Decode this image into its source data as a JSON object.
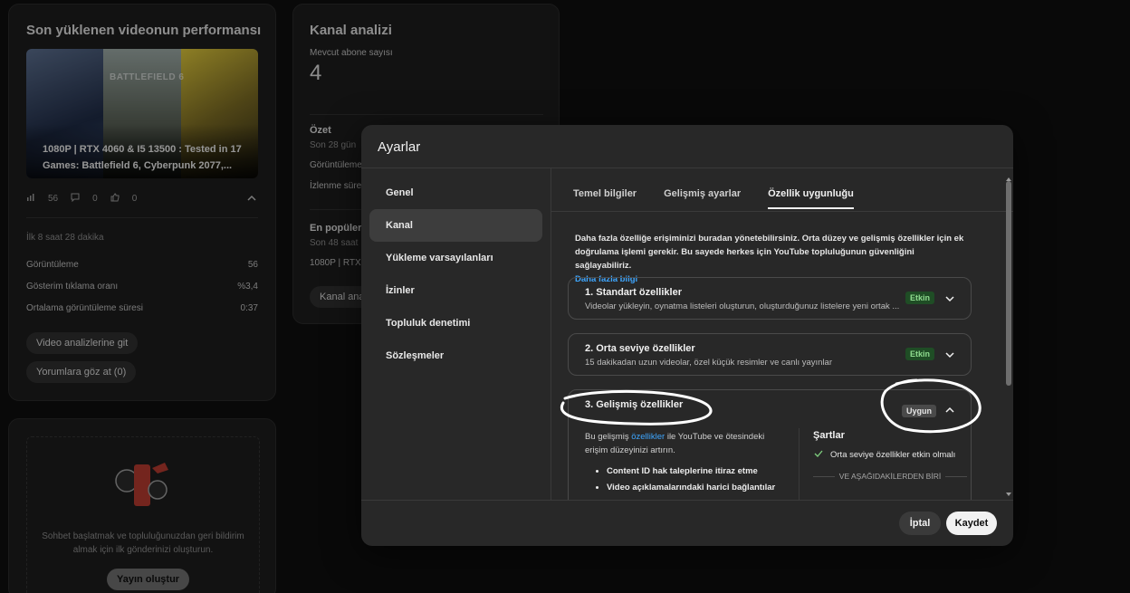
{
  "background": {
    "latest_video_card": {
      "title": "Son yüklenen videonun performansı",
      "thumb_labels": [
        "BATTLEFIELD 6"
      ],
      "video_title": "1080P | RTX 4060 & I5 13500 : Tested in 17 Games: Battlefield 6, Cyberpunk 2077,...",
      "views_count": "56",
      "comments_count": "0",
      "likes_count": "0",
      "period": "İlk 8 saat 28 dakika",
      "stats": [
        {
          "label": "Görüntüleme",
          "value": "56"
        },
        {
          "label": "Gösterim tıklama oranı",
          "value": "%3,4"
        },
        {
          "label": "Ortalama görüntüleme süresi",
          "value": "0:37"
        }
      ],
      "btn_analytics": "Video analizlerine git",
      "btn_comments": "Yorumlara göz at (0)"
    },
    "channel_card": {
      "title": "Kanal analizi",
      "subs_label": "Mevcut abone sayısı",
      "subs_value": "4",
      "summary_title": "Özet",
      "summary_period": "Son 28 gün",
      "summary_row1": "Görüntüleme",
      "summary_row2": "İzlenme süresi",
      "popular_title": "En popüler",
      "popular_period": "Son 48 saat",
      "popular_item": "1080P | RTX 4",
      "btn_channel": "Kanal ana"
    },
    "community_card": {
      "text": "Sohbet başlatmak ve topluluğunuzdan geri bildirim almak için ilk gönderinizi oluşturun.",
      "btn_create": "Yayın oluştur"
    }
  },
  "modal": {
    "title": "Ayarlar",
    "nav": [
      {
        "label": "Genel"
      },
      {
        "label": "Kanal"
      },
      {
        "label": "Yükleme varsayılanları"
      },
      {
        "label": "İzinler"
      },
      {
        "label": "Topluluk denetimi"
      },
      {
        "label": "Sözleşmeler"
      }
    ],
    "tabs": [
      {
        "label": "Temel bilgiler"
      },
      {
        "label": "Gelişmiş ayarlar"
      },
      {
        "label": "Özellik uygunluğu"
      }
    ],
    "intro_text": "Daha fazla özelliğe erişiminizi buradan yönetebilirsiniz. Orta düzey ve gelişmiş özellikler için ek doğrulama işlemi gerekir. Bu sayede herkes için YouTube topluluğunun güvenliğini sağlayabiliriz.",
    "intro_link": "Daha fazla bilgi",
    "features": [
      {
        "title": "1. Standart özellikler",
        "desc": "Videolar yükleyin, oynatma listeleri oluşturun, oluşturduğunuz listelere yeni ortak ...",
        "badge": "Etkin"
      },
      {
        "title": "2. Orta seviye özellikler",
        "desc": "15 dakikadan uzun videolar, özel küçük resimler ve canlı yayınlar",
        "badge": "Etkin"
      },
      {
        "title": "3. Gelişmiş özellikler",
        "badge": "Uygun"
      }
    ],
    "advanced": {
      "desc_pre": "Bu gelişmiş ",
      "desc_link": "özellikler",
      "desc_post": " ile YouTube ve ötesindeki erişim düzeyinizi artırın.",
      "bullets": [
        "Content ID hak taleplerine itiraz etme",
        "Video açıklamalarındaki harici bağlantılar"
      ],
      "req_title": "Şartlar",
      "req_item": "Orta seviye özellikler etkin olmalı",
      "req_separator": "VE AŞAĞIDAKİLERDEN BİRİ"
    },
    "btn_cancel": "İptal",
    "btn_save": "Kaydet"
  }
}
